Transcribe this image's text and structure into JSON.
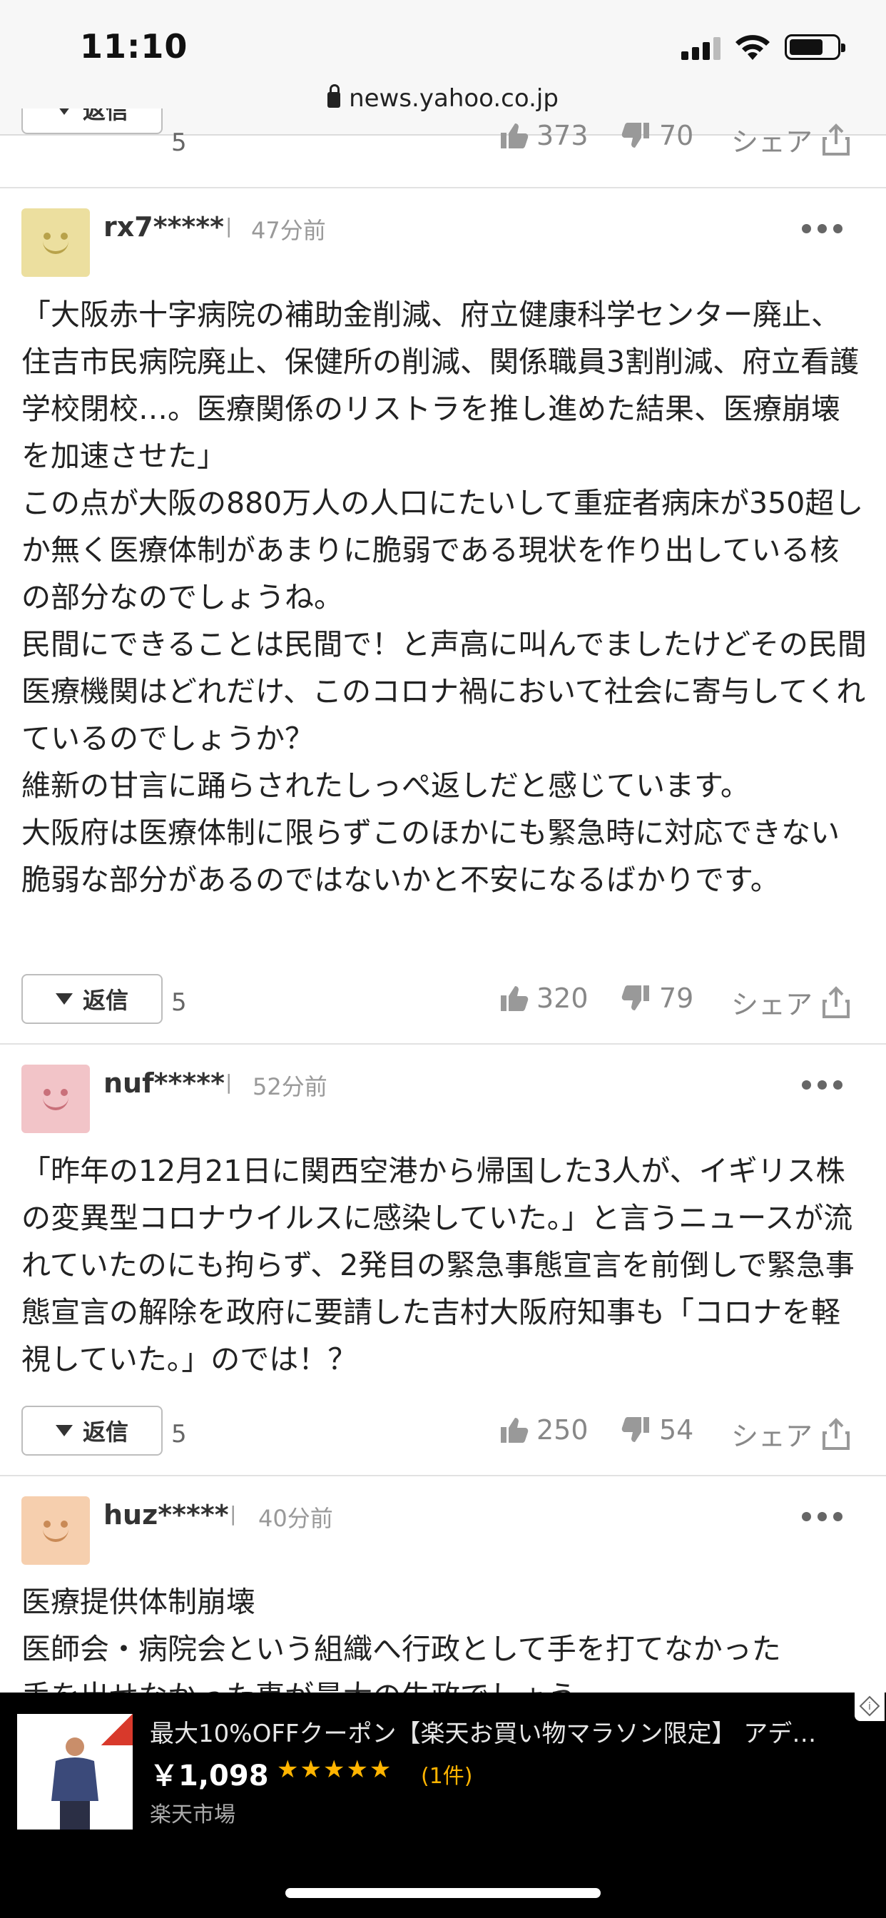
{
  "status_bar": {
    "time": "11:10"
  },
  "browser": {
    "url": "news.yahoo.co.jp"
  },
  "top_actions": {
    "reply_label": "返信",
    "reply_count": "5",
    "likes": "373",
    "dislikes": "70",
    "share_label": "シェア"
  },
  "comments": [
    {
      "username": "rx7*****",
      "time_ago": "47分前",
      "avatar_color": "#ecdf9f",
      "face_color": "#b8a24a",
      "body": "「大阪赤十字病院の補助金削減、府立健康科学センター廃止、住吉市民病院廃止、保健所の削減、関係職員3割削減、府立看護学校閉校…。医療関係のリストラを推し進めた結果、医療崩壊を加速させた」\nこの点が大阪の880万人の人口にたいして重症者病床が350超しか無く医療体制があまりに脆弱である現状を作り出している核の部分なのでしょうね。\n民間にできることは民間で！と声高に叫んでましたけどその民間医療機関はどれだけ、このコロナ禍において社会に寄与してくれているのでしょうか？\n維新の甘言に踊らされたしっぺ返しだと感じています。\n大阪府は医療体制に限らずこのほかにも緊急時に対応できない脆弱な部分があるのではないかと不安になるばかりです。",
      "reply_label": "返信",
      "reply_count": "5",
      "likes": "320",
      "dislikes": "79",
      "share_label": "シェア"
    },
    {
      "username": "nuf*****",
      "time_ago": "52分前",
      "avatar_color": "#f2c4c8",
      "face_color": "#c9707a",
      "body": "「昨年の12月21日に関西空港から帰国した3人が、イギリス株の変異型コロナウイルスに感染していた。」と言うニュースが流れていたのにも拘らず、2発目の緊急事態宣言を前倒しで緊急事態宣言の解除を政府に要請した吉村大阪府知事も「コロナを軽視していた。」のでは！？",
      "reply_label": "返信",
      "reply_count": "5",
      "likes": "250",
      "dislikes": "54",
      "share_label": "シェア"
    },
    {
      "username": "huz*****",
      "time_ago": "40分前",
      "avatar_color": "#f6cfae",
      "face_color": "#c98a56",
      "body": "医療提供体制崩壊\n医師会・病院会という組織へ行政として手を打てなかった\n手を出せなかった事が最大の失政でしょう"
    }
  ],
  "ad": {
    "title": "最大10%OFFクーポン【楽天お買い物マラソン限定】 アデ…",
    "price": "￥1,098",
    "stars": "★★★★★",
    "rating_count": "(1件)",
    "store": "楽天市場"
  }
}
